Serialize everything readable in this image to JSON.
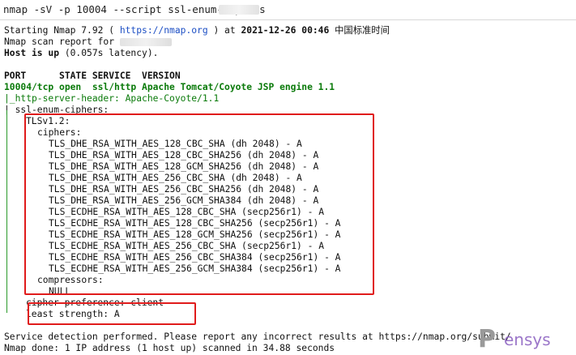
{
  "header": {
    "command": "nmap -sV -p 10004 --script ssl-enum-ciphers"
  },
  "terminal": {
    "start_prefix": "Starting Nmap 7.92 ( ",
    "start_url": "https://nmap.org",
    "start_mid": " ) at ",
    "start_time": "2021-12-26 00:46",
    "start_tz": " 中国标准时间",
    "report_line": "Nmap scan report for",
    "host_up_label": "Host is up",
    "host_up_latency": " (0.057s latency).",
    "columns": "PORT      STATE SERVICE  VERSION",
    "port_line": "10004/tcp open  ssl/http Apache Tomcat/Coyote JSP engine 1.1",
    "http_header": "|_http-server-header: Apache-Coyote/1.1",
    "ssl_enum": "| ssl-enum-ciphers:",
    "tls_version": "TLSv1.2:",
    "ciphers_label": "ciphers:",
    "ciphers": [
      "TLS_DHE_RSA_WITH_AES_128_CBC_SHA (dh 2048) - A",
      "TLS_DHE_RSA_WITH_AES_128_CBC_SHA256 (dh 2048) - A",
      "TLS_DHE_RSA_WITH_AES_128_GCM_SHA256 (dh 2048) - A",
      "TLS_DHE_RSA_WITH_AES_256_CBC_SHA (dh 2048) - A",
      "TLS_DHE_RSA_WITH_AES_256_CBC_SHA256 (dh 2048) - A",
      "TLS_DHE_RSA_WITH_AES_256_GCM_SHA384 (dh 2048) - A",
      "TLS_ECDHE_RSA_WITH_AES_128_CBC_SHA (secp256r1) - A",
      "TLS_ECDHE_RSA_WITH_AES_128_CBC_SHA256 (secp256r1) - A",
      "TLS_ECDHE_RSA_WITH_AES_128_GCM_SHA256 (secp256r1) - A",
      "TLS_ECDHE_RSA_WITH_AES_256_CBC_SHA (secp256r1) - A",
      "TLS_ECDHE_RSA_WITH_AES_256_CBC_SHA384 (secp256r1) - A",
      "TLS_ECDHE_RSA_WITH_AES_256_GCM_SHA384 (secp256r1) - A"
    ],
    "compressors_label": "compressors:",
    "compressor_value": "NULL",
    "cipher_pref": "cipher preference: client",
    "least_strength": "least strength: A",
    "detection_prefix": "Service detection performed. Please report any incorrect results at ",
    "detection_url": "https://nmap.org/submit/",
    "done_line": "Nmap done: 1 IP address (1 host up) scanned in 34.88 seconds"
  },
  "watermark": {
    "text": "ensys"
  },
  "colors": {
    "highlight": "#e01b1b",
    "green": "#0a7a0a",
    "link": "#1d4fc4",
    "bold_blue": "#1d4fc4"
  }
}
